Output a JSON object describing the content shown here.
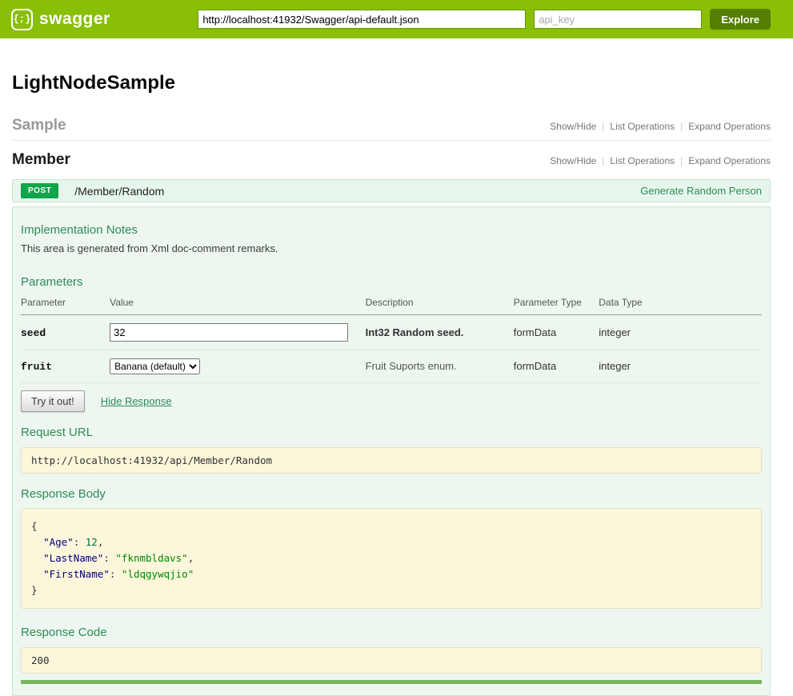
{
  "colors": {
    "header-green": "#89bf04",
    "explore-green": "#547f00",
    "post-green": "#10a54a",
    "accent-green": "#2e8b57",
    "panel-bg": "#edf7f0",
    "panel-border": "#c3e8d1",
    "heading-bg": "#e7f6ec",
    "pre-bg": "#fcf6db",
    "pre-border": "#e5e0c6",
    "json-key": "#000080",
    "json-string": "#008800",
    "json-number": "#006b47"
  },
  "header": {
    "brand": "swagger",
    "url_value": "http://localhost:41932/Swagger/api-default.json",
    "api_key_placeholder": "api_key",
    "explore_label": "Explore"
  },
  "page": {
    "title": "LightNodeSample"
  },
  "sections": [
    {
      "title": "Sample",
      "links": {
        "show_hide": "Show/Hide",
        "list_operations": "List Operations",
        "expand_operations": "Expand Operations"
      }
    },
    {
      "title": "Member",
      "links": {
        "show_hide": "Show/Hide",
        "list_operations": "List Operations",
        "expand_operations": "Expand Operations"
      }
    }
  ],
  "operation": {
    "method": "POST",
    "path": "/Member/Random",
    "action_link": "Generate Random Person",
    "notes_title": "Implementation Notes",
    "notes_text": "This area is generated from Xml doc-comment remarks.",
    "parameters_title": "Parameters",
    "table_headers": [
      "Parameter",
      "Value",
      "Description",
      "Parameter Type",
      "Data Type"
    ],
    "rows": [
      {
        "parameter": "seed",
        "value": "32",
        "description": "Int32 Random seed.",
        "parameter_type": "formData",
        "data_type": "integer"
      },
      {
        "parameter": "fruit",
        "selected_option": "Banana (default)",
        "description": "Fruit Suports enum.",
        "parameter_type": "formData",
        "data_type": "integer"
      }
    ],
    "try_it_label": "Try it out!",
    "hide_response_label": "Hide Response",
    "request_url_title": "Request URL",
    "request_url": "http://localhost:41932/api/Member/Random",
    "response_body_title": "Response Body",
    "response_body_lines": [
      [
        {
          "text": "{",
          "type": "plain"
        }
      ],
      [
        {
          "text": "  ",
          "type": "plain"
        },
        {
          "text": "\"Age\"",
          "type": "key"
        },
        {
          "text": ": ",
          "type": "plain"
        },
        {
          "text": "12",
          "type": "number"
        },
        {
          "text": ",",
          "type": "plain"
        }
      ],
      [
        {
          "text": "  ",
          "type": "plain"
        },
        {
          "text": "\"LastName\"",
          "type": "key"
        },
        {
          "text": ": ",
          "type": "plain"
        },
        {
          "text": "\"fknmbldavs\"",
          "type": "string"
        },
        {
          "text": ",",
          "type": "plain"
        }
      ],
      [
        {
          "text": "  ",
          "type": "plain"
        },
        {
          "text": "\"FirstName\"",
          "type": "key"
        },
        {
          "text": ": ",
          "type": "plain"
        },
        {
          "text": "\"ldqgywqjio\"",
          "type": "string"
        }
      ],
      [
        {
          "text": "}",
          "type": "plain"
        }
      ]
    ],
    "response_code_title": "Response Code",
    "response_code": "200"
  }
}
